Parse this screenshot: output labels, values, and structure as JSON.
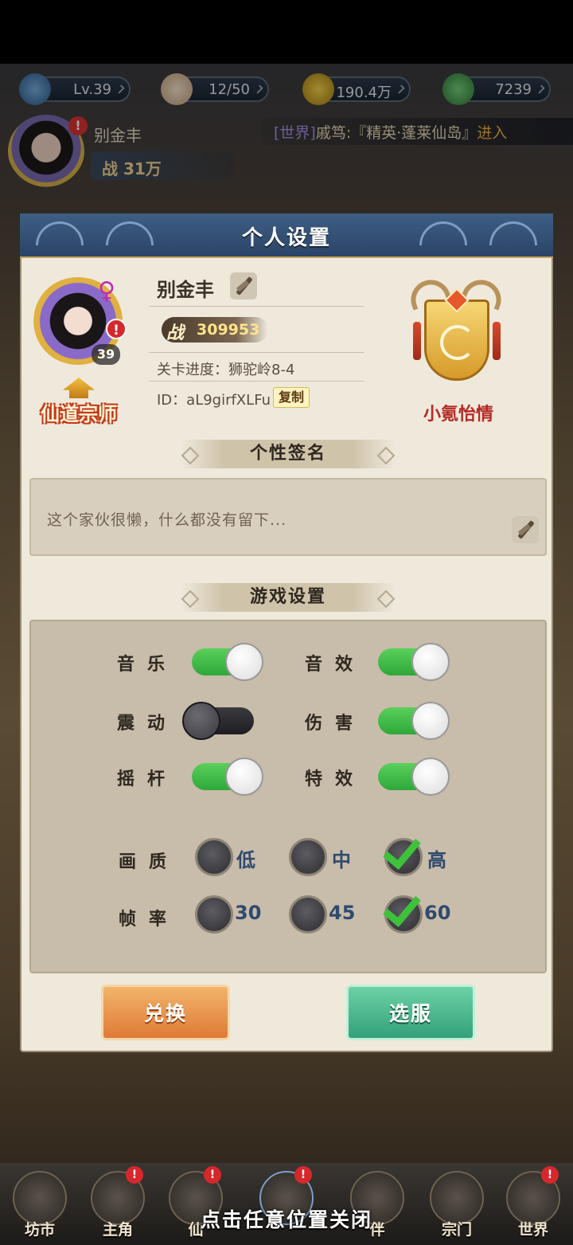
{
  "resources": [
    {
      "icon": "swirl-icon",
      "value": "Lv.39"
    },
    {
      "icon": "bun-icon",
      "value": "12/50"
    },
    {
      "icon": "coin-icon",
      "value": "190.4万"
    },
    {
      "icon": "leaf-gem-icon",
      "value": "7239"
    }
  ],
  "background_player": {
    "name": "别金丰",
    "power": "战 31万",
    "alert": "!"
  },
  "world_ticker": {
    "channel": "[世界]",
    "message": "戚笃:『精英·蓬莱仙岛』",
    "action": "进入"
  },
  "dialog": {
    "title": "个人设置",
    "profile": {
      "female_symbol": "♀",
      "alert": "!",
      "level": "39",
      "title_badge": "仙道宗师",
      "name": "别金丰",
      "power_label": "战",
      "power_value": "309953",
      "stage": "关卡进度：狮驼岭8-4",
      "id": "ID：aL9girfXLFu",
      "copy_label": "复制",
      "guild_name": "小氪怡情"
    },
    "signature": {
      "section_title": "个性签名",
      "text": "这个家伙很懒，什么都没有留下..."
    },
    "game_settings": {
      "section_title": "游戏设置",
      "toggles": [
        {
          "label": "音乐",
          "on": true
        },
        {
          "label": "音效",
          "on": true
        },
        {
          "label": "震动",
          "on": false
        },
        {
          "label": "伤害",
          "on": true
        },
        {
          "label": "摇杆",
          "on": true
        },
        {
          "label": "特效",
          "on": true
        }
      ],
      "quality": {
        "label": "画质",
        "options": [
          "低",
          "中",
          "高"
        ],
        "selected": "高"
      },
      "framerate": {
        "label": "帧率",
        "options": [
          "30",
          "45",
          "60"
        ],
        "selected": "60"
      }
    },
    "buttons": {
      "exchange": "兑换",
      "select_server": "选服"
    }
  },
  "bottom_nav": [
    {
      "label": "坊市",
      "badge": ""
    },
    {
      "label": "主角",
      "badge": "!"
    },
    {
      "label": "仙",
      "badge": "!"
    },
    {
      "label": "",
      "badge": "!"
    },
    {
      "label": "伴",
      "badge": ""
    },
    {
      "label": "宗门",
      "badge": ""
    },
    {
      "label": "世界",
      "badge": "!"
    }
  ],
  "close_hint": "点击任意位置关闭",
  "colors": {
    "toggle_on": "#3ec23a",
    "dialog_header": "#2b4467",
    "guild_name": "#b42a24",
    "option_text": "#2f4a6e"
  }
}
